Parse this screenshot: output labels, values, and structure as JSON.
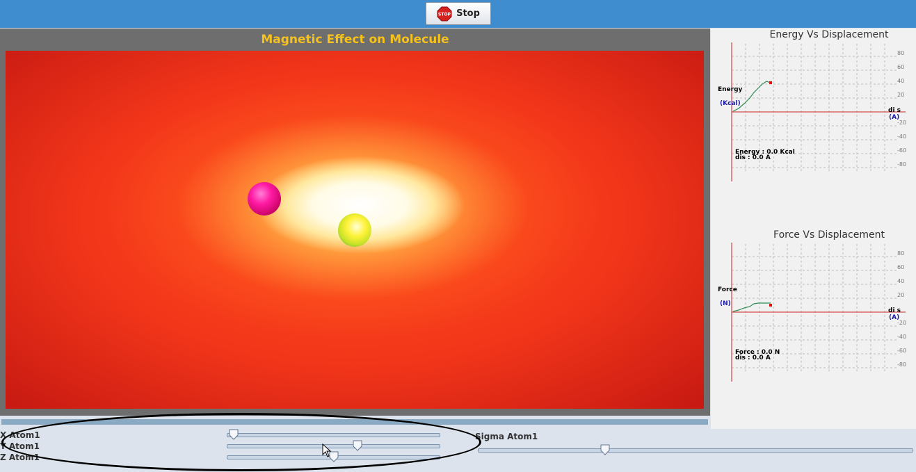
{
  "toolbar": {
    "stop_label": "Stop",
    "stop_icon": "stop-sign-icon",
    "stop_icon_text": "STOP"
  },
  "simulation": {
    "title": "Magnetic Effect on Molecule",
    "atoms": [
      "magenta-atom",
      "yellow-atom"
    ]
  },
  "energy_graph": {
    "title": "Energy Vs Displacement",
    "y_label": "Energy",
    "y_unit": "(Kcal)",
    "x_label": "di s",
    "x_unit": "(A)",
    "readout_value": "Energy : 0.0 Kcal",
    "readout_dis": "dis : 0.0 A",
    "ticks": [
      "80",
      "60",
      "40",
      "20",
      "-20",
      "-40",
      "-60",
      "-80"
    ]
  },
  "force_graph": {
    "title": "Force Vs Displacement",
    "y_label": "Force",
    "y_unit": "(N)",
    "x_label": "di s",
    "x_unit": "(A)",
    "readout_value": "Force : 0.0 N",
    "readout_dis": "dis : 0.0 A",
    "ticks": [
      "80",
      "60",
      "40",
      "20",
      "-20",
      "-40",
      "-60",
      "-80"
    ]
  },
  "controls": {
    "x_atom_label": "X Atom1",
    "y_atom_label": "Y Atom1",
    "z_atom_label": "Z Atom1",
    "sigma_atom_label": "Sigma Atom1"
  },
  "colors": {
    "topbar": "#3f8ccf",
    "title": "#f7c21a",
    "axis": "#cc2222",
    "curve": "#2e8b57",
    "marker": "#e01010",
    "unit": "#1a1aa6"
  }
}
